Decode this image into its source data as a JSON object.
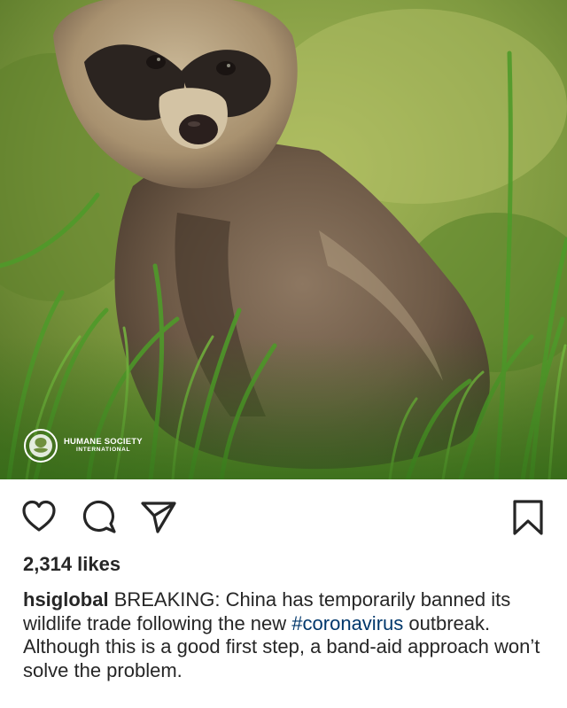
{
  "post": {
    "image_subject": "raccoon dog in grass",
    "watermark": {
      "line1": "HUMANE SOCIETY",
      "line2": "INTERNATIONAL"
    },
    "actions": {
      "like_icon": "heart-icon",
      "comment_icon": "comment-bubble-icon",
      "share_icon": "paper-plane-icon",
      "save_icon": "bookmark-icon"
    },
    "likes": "2,314 likes",
    "caption": {
      "username": "hsiglobal",
      "text_before": "BREAKING: China has temporarily banned its wildlife trade following the new",
      "hashtag": "#coronavirus",
      "text_after": "outbreak. Although this is a good first step, a band-aid approach won’t solve the problem."
    },
    "colors": {
      "text": "#262626",
      "hashtag": "#00376b",
      "background": "#ffffff"
    }
  }
}
